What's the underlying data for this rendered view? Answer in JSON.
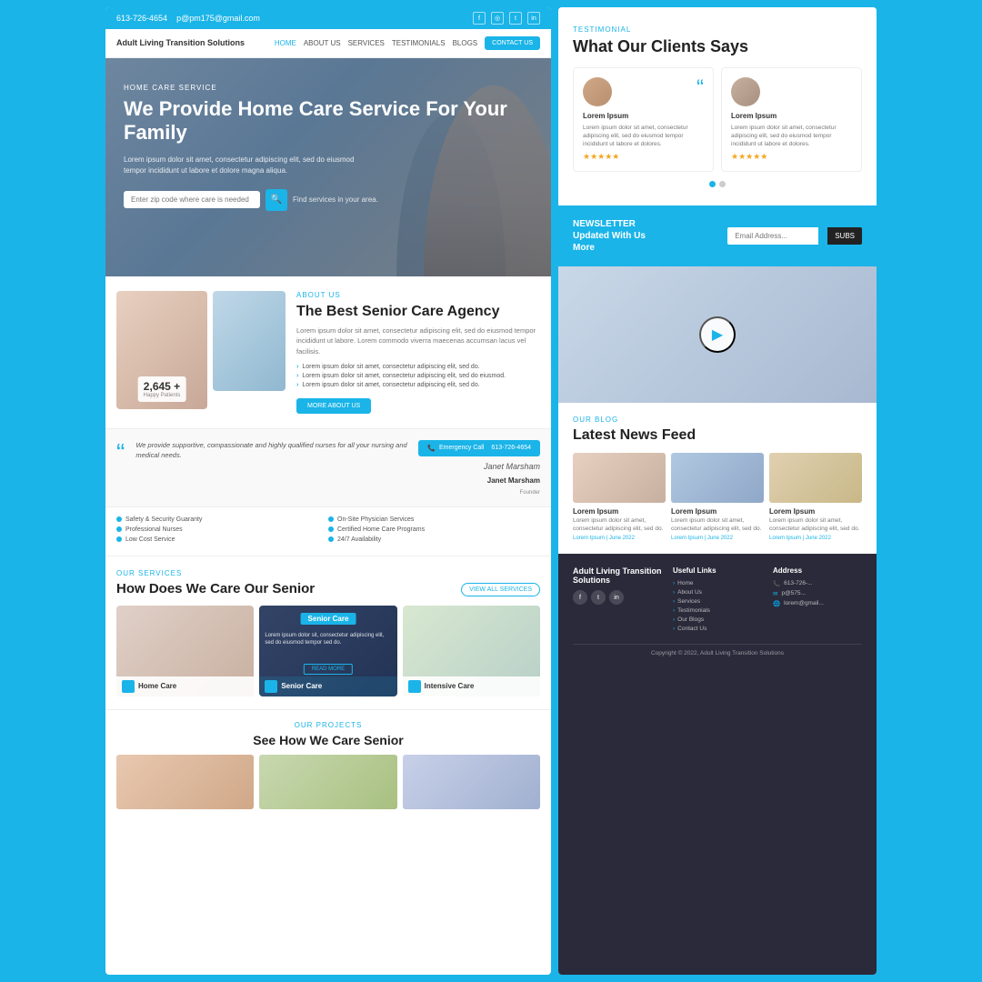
{
  "topbar": {
    "phone": "613-726-4654",
    "email": "p@pm175@gmail.com"
  },
  "logo": {
    "name": "Adult Living Transition Solutions"
  },
  "nav": {
    "links": [
      "HOME",
      "ABOUT US",
      "SERVICES",
      "TESTIMONIALS",
      "BLOGS"
    ],
    "contact_btn": "CONTACT US"
  },
  "hero": {
    "tag": "HOME CARE SERVICE",
    "title": "We Provide Home Care Service For Your Family",
    "description": "Lorem ipsum dolor sit amet, consectetur adipiscing elit, sed do eiusmod tempor incididunt ut labore et dolore magna aliqua.",
    "input_placeholder": "Enter zip code where care is needed",
    "find_text": "Find services in your area."
  },
  "about": {
    "tag": "ABOUT US",
    "title": "The Best Senior Care Agency",
    "description": "Lorem ipsum dolor sit amet, consectetur adipiscing elit, sed do eiusmod tempor incididunt ut labore. Lorem commodo viverra maecenas accumsan lacus vel facilisis.",
    "list": [
      "Lorem ipsum dolor sit amet, consectetur adipiscing elit, sed do.",
      "Lorem ipsum dolor sit amet, consectetur adipiscing elit, sed do eiusmod.",
      "Lorem ipsum dolor sit amet, consectetur adipiscing elit, sed do."
    ],
    "more_btn": "MORE ABOUT US",
    "happy_patients": "2,645 +",
    "happy_label": "Happy Patients"
  },
  "quote": {
    "text": "We provide supportive, compassionate and highly qualified nurses for all your nursing and medical needs.",
    "emergency_label": "Emergency Call",
    "phone": "613-726-4654",
    "signature": "Janet Marsham",
    "role": "Founder"
  },
  "features": {
    "left": [
      "Safety & Security Guaranty",
      "Professional Nurses",
      "Low Cost Service"
    ],
    "right": [
      "On-Site Physician Services",
      "Certified Home Care Programs",
      "24/7 Availability"
    ]
  },
  "services": {
    "tag": "OUR SERVICES",
    "title": "How Does We Care Our Senior",
    "view_all": "VIEW ALL SERVICES",
    "cards": [
      {
        "name": "Home Care"
      },
      {
        "name": "Senior Care",
        "desc": "Lorem ipsum dolor sit, consectetur adipiscing elit, sed do eiusmod tempor sed do."
      },
      {
        "name": "Intensive Care"
      }
    ]
  },
  "projects": {
    "tag": "OUR PROJECTS",
    "title": "See How We Care Senior"
  },
  "testimonial": {
    "tag": "TESTIMONIAL",
    "title": "What Our Clients Says",
    "cards": [
      {
        "name": "Lorem Ipsum",
        "text": "Lorem ipsum dolor sit amet, consectetur adipiscing elit, sed do eiusmod tempor incididunt ut labore et dolores.",
        "stars": "★★★★★"
      },
      {
        "name": "Lorem Ipsum",
        "text": "Lorem ipsum dolor sit amet, consectetur adipiscing elit, sed do eiusmod tempor incididunt ut labore et dolores.",
        "stars": "★★★★★"
      }
    ]
  },
  "newsletter": {
    "pre": "NEWSLETTER",
    "title": "Updated With Us",
    "subtitle": "More",
    "placeholder": "Email Address...",
    "btn": "SUBS"
  },
  "blog": {
    "tag": "OUR BLOG",
    "title": "Latest News Feed",
    "posts": [
      {
        "title": "Lorem Ipsum",
        "text": "Lorem ipsum dolor sit amet, consectetur adipiscing elit, sed do.",
        "meta": "Lorem Ipsum | June 2022"
      },
      {
        "title": "Lorem Ipsum",
        "text": "Lorem ipsum dolor sit amet, consectetur adipiscing elit, sed do.",
        "meta": "Lorem Ipsum | June 2022"
      },
      {
        "title": "Lorem Ipsum",
        "text": "Lorem ipsum dolor sit amet, consectetur adipiscing elit, sed do.",
        "meta": "Lorem Ipsum | June 2022"
      }
    ]
  },
  "footer": {
    "logo": "Adult Living Transition Solutions",
    "links_title": "Useful Links",
    "address_title": "Address",
    "links": [
      "Home",
      "About Us",
      "Services",
      "Testimonials",
      "Our Blogs",
      "Contact Us"
    ],
    "contacts": [
      "613-726-...",
      "p@575...",
      "lorem@gmail..."
    ],
    "copyright": "Copyright © 2022, Adult Living Transition Solutions"
  }
}
